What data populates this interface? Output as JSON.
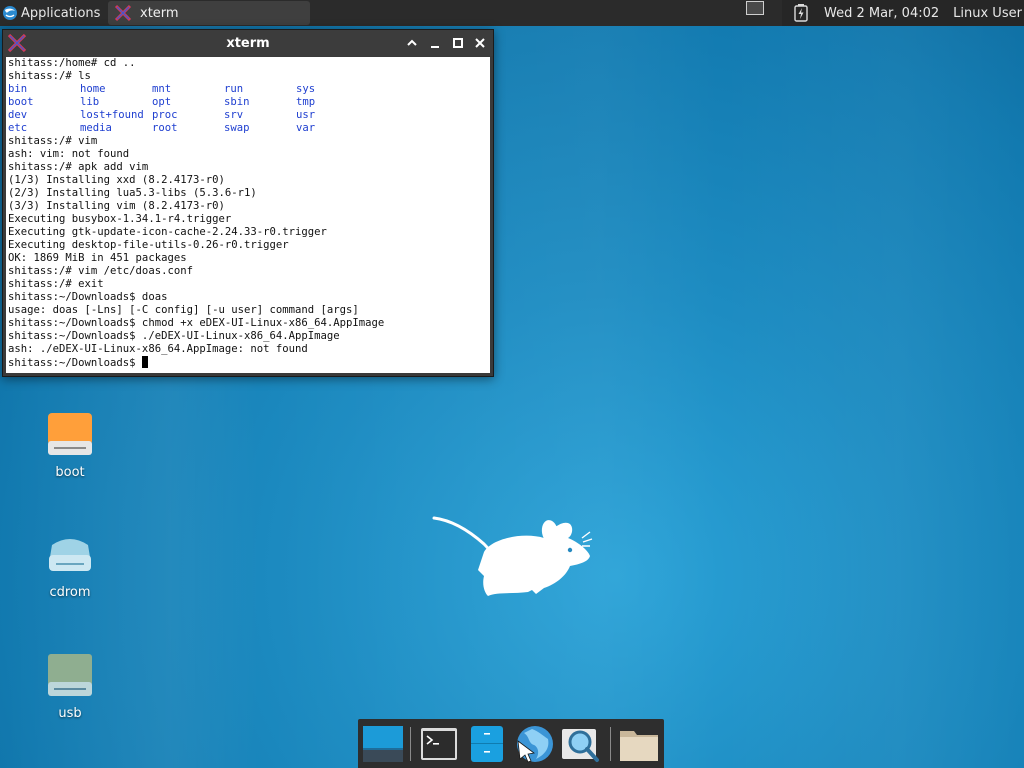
{
  "top_panel": {
    "applications_label": "Applications",
    "applications_separator": "⋮",
    "task_title": "xterm",
    "clock": "Wed  2 Mar, 04:02",
    "user": "Linux User"
  },
  "xterm": {
    "title": "xterm",
    "lines_before_ls": [
      "shitass:/home# cd ..",
      "shitass:/# ls"
    ],
    "ls_output": [
      [
        "bin",
        "home",
        "mnt",
        "run",
        "sys"
      ],
      [
        "boot",
        "lib",
        "opt",
        "sbin",
        "tmp"
      ],
      [
        "dev",
        "lost+found",
        "proc",
        "srv",
        "usr"
      ],
      [
        "etc",
        "media",
        "root",
        "swap",
        "var"
      ]
    ],
    "lines_after_ls": [
      "shitass:/# vim",
      "ash: vim: not found",
      "shitass:/# apk add vim",
      "(1/3) Installing xxd (8.2.4173-r0)",
      "(2/3) Installing lua5.3-libs (5.3.6-r1)",
      "(3/3) Installing vim (8.2.4173-r0)",
      "Executing busybox-1.34.1-r4.trigger",
      "Executing gtk-update-icon-cache-2.24.33-r0.trigger",
      "Executing desktop-file-utils-0.26-r0.trigger",
      "OK: 1869 MiB in 451 packages",
      "shitass:/# vim /etc/doas.conf",
      "shitass:/# exit",
      "shitass:~/Downloads$ doas",
      "usage: doas [-Lns] [-C config] [-u user] command [args]",
      "shitass:~/Downloads$ chmod +x eDEX-UI-Linux-x86_64.AppImage",
      "shitass:~/Downloads$ ./eDEX-UI-Linux-x86_64.AppImage",
      "ash: ./eDEX-UI-Linux-x86_64.AppImage: not found"
    ],
    "prompt": "shitass:~/Downloads$ ",
    "ls_color": "#1f3fd0"
  },
  "desktop_icons": [
    {
      "label": "boot",
      "icon": "drive-harddisk-icon"
    },
    {
      "label": "cdrom",
      "icon": "drive-optical-icon"
    },
    {
      "label": "usb",
      "icon": "drive-removable-icon"
    }
  ],
  "dock": {
    "items": [
      "show-desktop-icon",
      "terminal-icon",
      "file-manager-icon",
      "web-browser-icon",
      "app-finder-icon",
      "home-folder-icon"
    ]
  },
  "colors": {
    "wallpaper": "#1d8cc2",
    "panel": "#2b2b2b",
    "terminal_bg": "#ffffff"
  }
}
